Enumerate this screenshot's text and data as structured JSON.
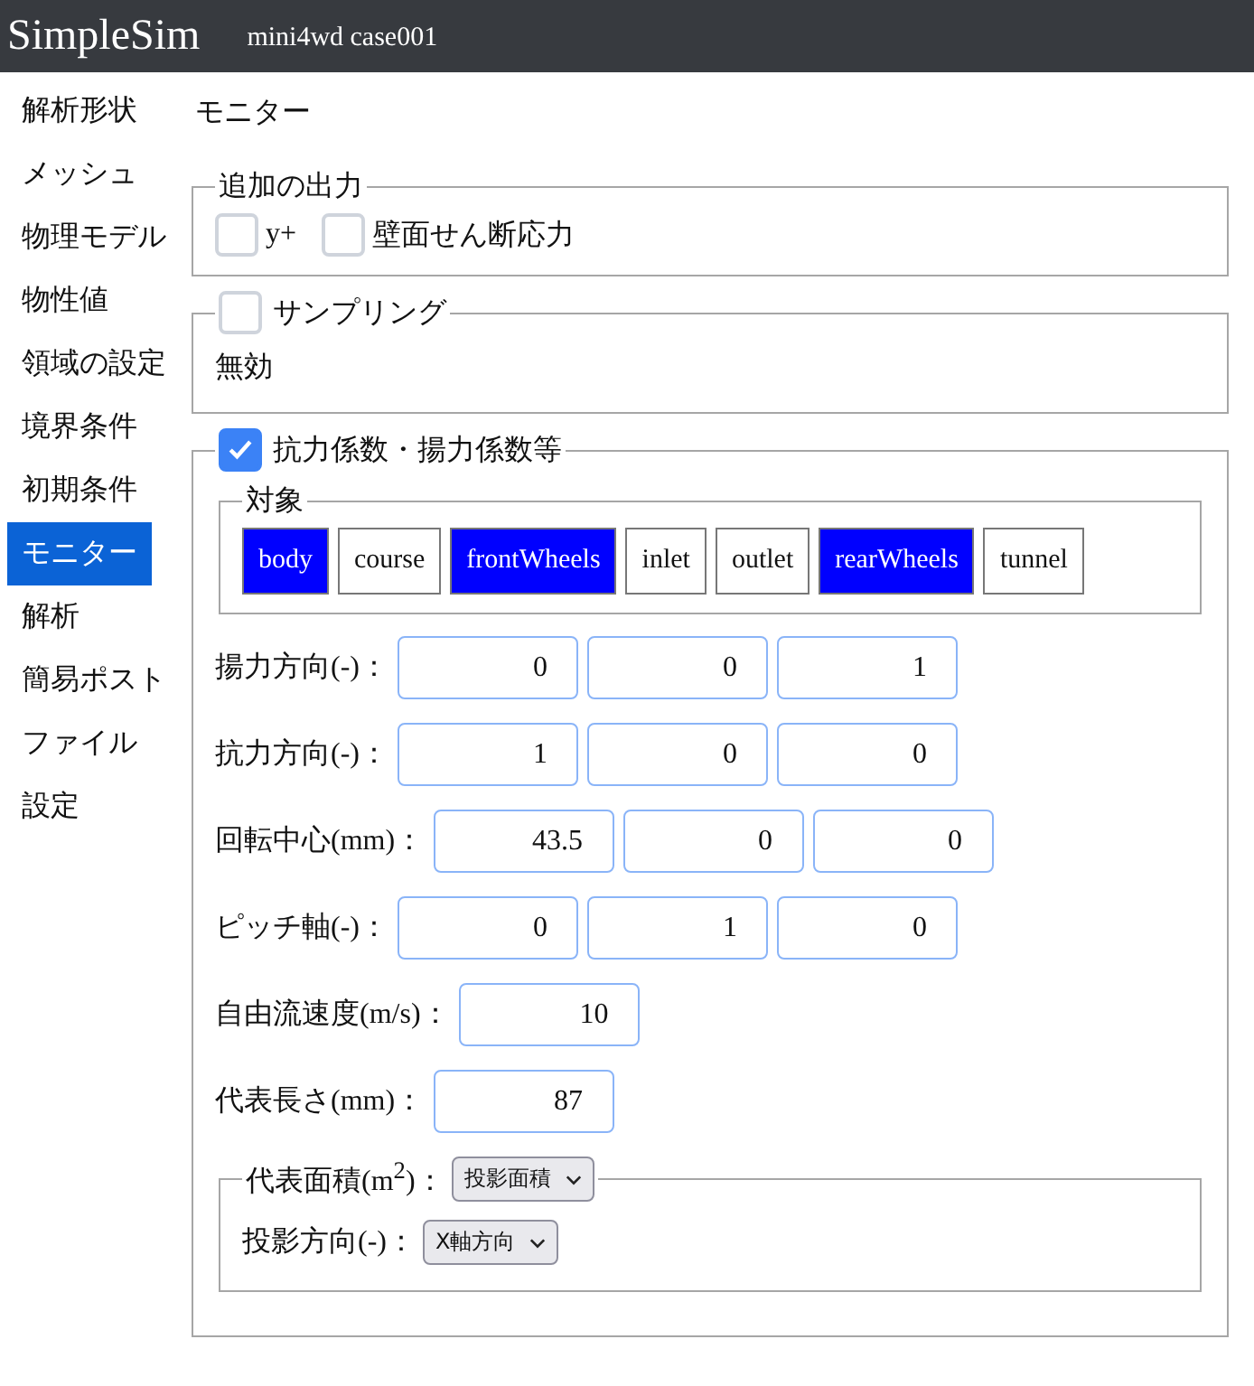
{
  "header": {
    "title": "SimpleSim",
    "case": "mini4wd case001"
  },
  "sidebar": {
    "items": [
      {
        "label": "解析形状",
        "selected": false
      },
      {
        "label": "メッシュ",
        "selected": false
      },
      {
        "label": "物理モデル",
        "selected": false
      },
      {
        "label": "物性値",
        "selected": false
      },
      {
        "label": "領域の設定",
        "selected": false
      },
      {
        "label": "境界条件",
        "selected": false
      },
      {
        "label": "初期条件",
        "selected": false
      },
      {
        "label": "モニター",
        "selected": true
      },
      {
        "label": "解析",
        "selected": false
      },
      {
        "label": "簡易ポスト",
        "selected": false
      },
      {
        "label": "ファイル",
        "selected": false
      },
      {
        "label": "設定",
        "selected": false
      }
    ]
  },
  "page_title": "モニター",
  "additional_output": {
    "legend": "追加の出力",
    "options": [
      {
        "label": "y+",
        "checked": false
      },
      {
        "label": "壁面せん断応力",
        "checked": false
      }
    ]
  },
  "sampling": {
    "label": "サンプリング",
    "checked": false,
    "status": "無効"
  },
  "force": {
    "label": "抗力係数・揚力係数等",
    "checked": true,
    "targets": {
      "legend": "対象",
      "items": [
        {
          "label": "body",
          "selected": true
        },
        {
          "label": "course",
          "selected": false
        },
        {
          "label": "frontWheels",
          "selected": true
        },
        {
          "label": "inlet",
          "selected": false
        },
        {
          "label": "outlet",
          "selected": false
        },
        {
          "label": "rearWheels",
          "selected": true
        },
        {
          "label": "tunnel",
          "selected": false
        }
      ]
    },
    "vectors": [
      {
        "label": "揚力方向(-)：",
        "values": [
          "0",
          "0",
          "1"
        ]
      },
      {
        "label": "抗力方向(-)：",
        "values": [
          "1",
          "0",
          "0"
        ]
      },
      {
        "label": "回転中心(mm)：",
        "values": [
          "43.5",
          "0",
          "0"
        ]
      },
      {
        "label": "ピッチ軸(-)：",
        "values": [
          "0",
          "1",
          "0"
        ]
      }
    ],
    "scalars": [
      {
        "label": "自由流速度(m/s)：",
        "value": "10"
      },
      {
        "label": "代表長さ(mm)：",
        "value": "87"
      }
    ],
    "area": {
      "label": "代表面積(m$^{2}$)：",
      "select": "投影面積",
      "direction_label": "投影方向(-)：",
      "direction_select": "X軸方向"
    }
  }
}
